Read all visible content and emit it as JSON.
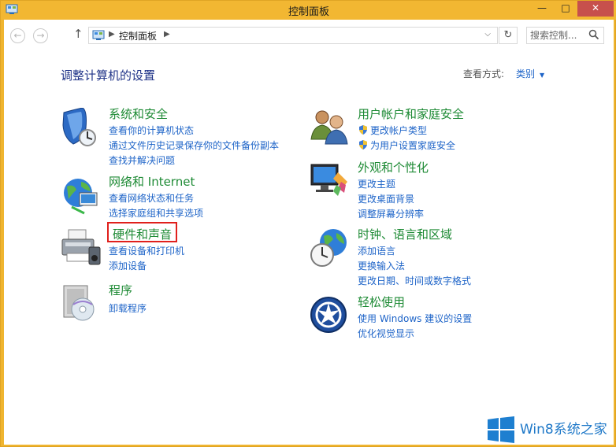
{
  "window": {
    "title": "控制面板",
    "min": "—",
    "max": "□",
    "close": "✕"
  },
  "nav": {
    "back": "←",
    "forward": "→",
    "up": "↑",
    "address": {
      "sep": "▶",
      "text": "控制面板",
      "chevron": "⌵"
    },
    "refresh": "↻",
    "search_placeholder": "搜索控制...",
    "search_icon": "search-icon"
  },
  "header": {
    "title": "调整计算机的设置",
    "view_label": "查看方式:",
    "view_value": "类别",
    "view_caret": "▼"
  },
  "categories": [
    {
      "icon": "system-security-icon",
      "title": "系统和安全",
      "links": [
        "查看你的计算机状态",
        "通过文件历史记录保存你的文件备份副本",
        "查找并解决问题"
      ]
    },
    {
      "icon": "network-icon",
      "title": "网络和 Internet",
      "links": [
        "查看网络状态和任务",
        "选择家庭组和共享选项"
      ]
    },
    {
      "icon": "hardware-sound-icon",
      "title": "硬件和声音",
      "links": [
        "查看设备和打印机",
        "添加设备"
      ]
    },
    {
      "icon": "programs-icon",
      "title": "程序",
      "links": [
        "卸载程序"
      ]
    },
    {
      "icon": "user-accounts-icon",
      "title": "用户帐户和家庭安全",
      "links": [
        "更改帐户类型",
        "为用户设置家庭安全"
      ]
    },
    {
      "icon": "appearance-icon",
      "title": "外观和个性化",
      "links": [
        "更改主题",
        "更改桌面背景",
        "调整屏幕分辨率"
      ]
    },
    {
      "icon": "clock-region-icon",
      "title": "时钟、语言和区域",
      "links": [
        "添加语言",
        "更换输入法",
        "更改日期、时间或数字格式"
      ]
    },
    {
      "icon": "ease-of-access-icon",
      "title": "轻松使用",
      "links": [
        "使用 Windows 建议的设置",
        "优化视觉显示"
      ]
    }
  ],
  "watermark": {
    "text": "Win8系统之家",
    "logo": "windows-logo-icon"
  },
  "colors": {
    "titlebar": "#f2b732",
    "link": "#1e64c8",
    "category": "#1d8a34",
    "highlight": "#e0201c",
    "close": "#c7504c"
  }
}
